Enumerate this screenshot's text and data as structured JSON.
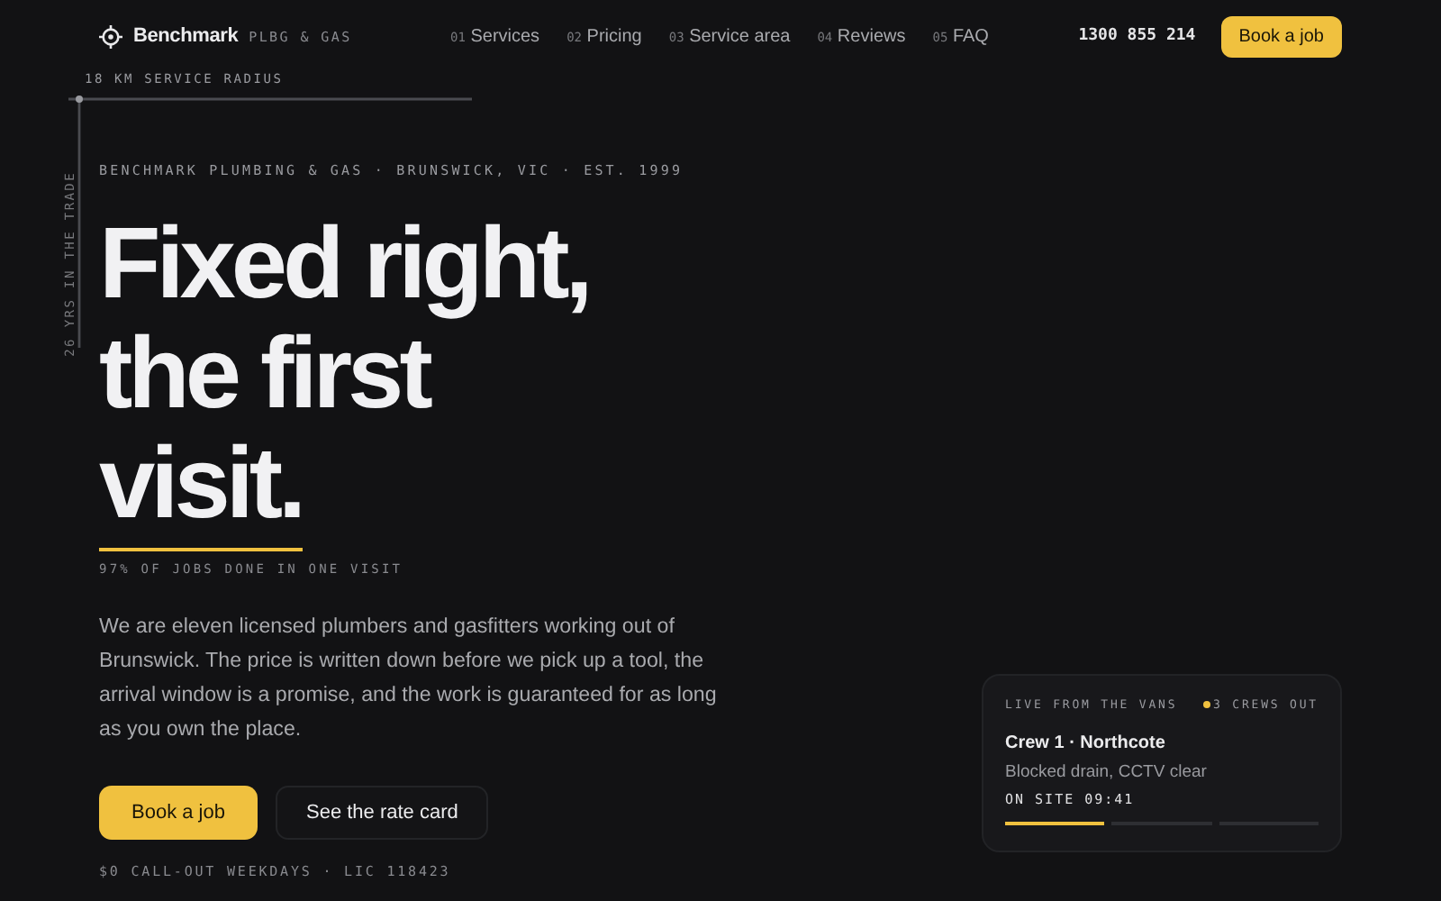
{
  "brand": {
    "name": "Benchmark",
    "tag": "PLBG & GAS"
  },
  "nav": [
    {
      "num": "01",
      "label": "Services"
    },
    {
      "num": "02",
      "label": "Pricing"
    },
    {
      "num": "03",
      "label": "Service area"
    },
    {
      "num": "04",
      "label": "Reviews"
    },
    {
      "num": "05",
      "label": "FAQ"
    }
  ],
  "phone": "1300 855 214",
  "header_cta": "Book a job",
  "radius_label": "18 KM SERVICE RADIUS",
  "years_label": "26 YRS IN THE TRADE",
  "eyebrow": "BENCHMARK PLUMBING & GAS · BRUNSWICK, VIC · EST. 1999",
  "headline": [
    "Fixed right,",
    "the first",
    "visit."
  ],
  "stat": "97% OF JOBS DONE IN ONE VISIT",
  "intro": "We are eleven licensed plumbers and gasfitters working out of Brunswick. The price is written down before we pick up a tool, the arrival window is a promise, and the work is guaranteed for as long as you own the place.",
  "buttons": [
    {
      "kind": "primary",
      "label": "Book a job"
    },
    {
      "kind": "secondary",
      "label": "See the rate card"
    }
  ],
  "footnote": "$0 CALL-OUT WEEKDAYS · LIC 118423",
  "live_card": {
    "title": "LIVE FROM THE VANS",
    "status": "3 CREWS OUT",
    "crew": "Crew 1 · Northcote",
    "job": "Blocked drain, CCTV clear",
    "time": "ON SITE 09:41",
    "segments": [
      {
        "active": true
      },
      {
        "active": false
      },
      {
        "active": false
      }
    ]
  }
}
